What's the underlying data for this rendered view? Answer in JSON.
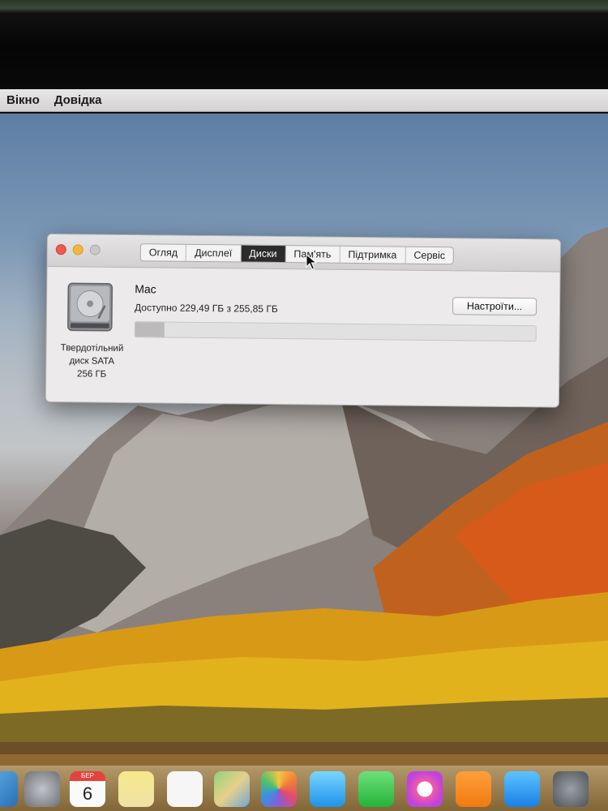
{
  "menubar": {
    "items": [
      {
        "label": "Вікно"
      },
      {
        "label": "Довідка"
      }
    ]
  },
  "window": {
    "tabs": [
      {
        "label": "Огляд"
      },
      {
        "label": "Дисплеї"
      },
      {
        "label": "Диски",
        "active": true
      },
      {
        "label": "Пам'ять"
      },
      {
        "label": "Підтримка"
      },
      {
        "label": "Сервіс"
      }
    ],
    "disk": {
      "icon": "hard-drive-icon",
      "caption_line1": "Твердотільний",
      "caption_line2": "диск SATA",
      "caption_line3": "256 ГБ"
    },
    "volume": {
      "name": "Mac",
      "free_text": "Доступно 229,49 ГБ з 255,85 ГБ",
      "used_fraction": 0.0736
    },
    "settings_label": "Настроїти..."
  },
  "dock": {
    "calendar_month": "БЕР",
    "calendar_day": "6",
    "icons": [
      "finder-icon",
      "launchpad-icon",
      "calendar-icon",
      "notes-icon",
      "reminders-icon",
      "maps-icon",
      "photos-icon",
      "messages-icon",
      "facetime-icon",
      "itunes-icon",
      "ibooks-icon",
      "app-store-icon",
      "system-preferences-icon"
    ]
  },
  "colors": {
    "close": "#ee5a52",
    "minimize": "#f3b73c",
    "tab_active": "#2b2b2b"
  }
}
